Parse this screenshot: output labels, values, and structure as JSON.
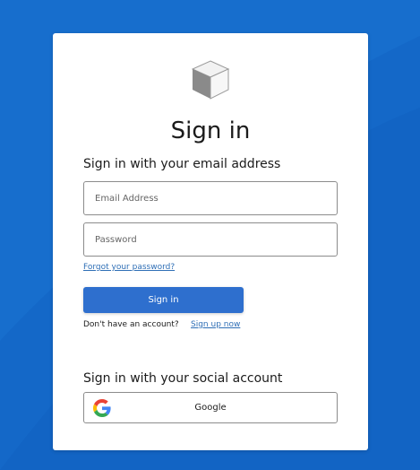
{
  "page": {
    "title": "Sign in",
    "email_subtitle": "Sign in with your email address",
    "social_subtitle": "Sign in with your social account"
  },
  "form": {
    "email_placeholder": "Email Address",
    "password_placeholder": "Password",
    "forgot_link": "Forgot your password?",
    "signin_button": "Sign in",
    "no_account_text": "Don't have an account?",
    "signup_link": "Sign up now"
  },
  "social": {
    "google_label": "Google",
    "google_icon": "google-g-logo"
  },
  "logo": {
    "icon": "cube-icon"
  },
  "colors": {
    "background": "#1468c8",
    "primary_button": "#2e6fce",
    "link": "#2f6fb6",
    "google_blue": "#4285f4",
    "google_red": "#ea4335",
    "google_yellow": "#fbbc05",
    "google_green": "#34a853"
  }
}
